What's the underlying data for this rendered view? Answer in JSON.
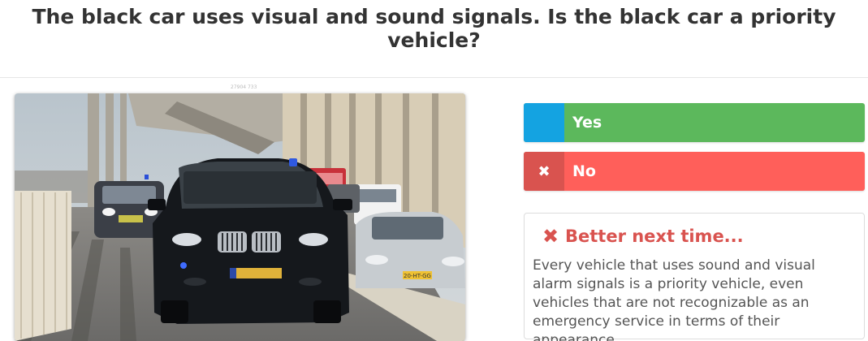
{
  "question": {
    "text": "The black car uses visual and sound signals. Is the black car a priority vehicle?"
  },
  "photo": {
    "caption": "27904 733",
    "plate_front": "",
    "plate_right": "20-HT-GG"
  },
  "answers": [
    {
      "label": "Yes",
      "marker": "",
      "marker_color": "#14a3e1",
      "color": "#5cb85c"
    },
    {
      "label": "No",
      "marker": "✖",
      "marker_color": "#d9534f",
      "color": "#ff5f5a"
    }
  ],
  "feedback": {
    "icon": "✖",
    "title": "Better next time...",
    "text": "Every vehicle that uses sound and visual alarm signals is a priority vehicle, even vehicles that are not recognizable as an emergency service in terms of their appearance.",
    "color": "#d9534f"
  }
}
